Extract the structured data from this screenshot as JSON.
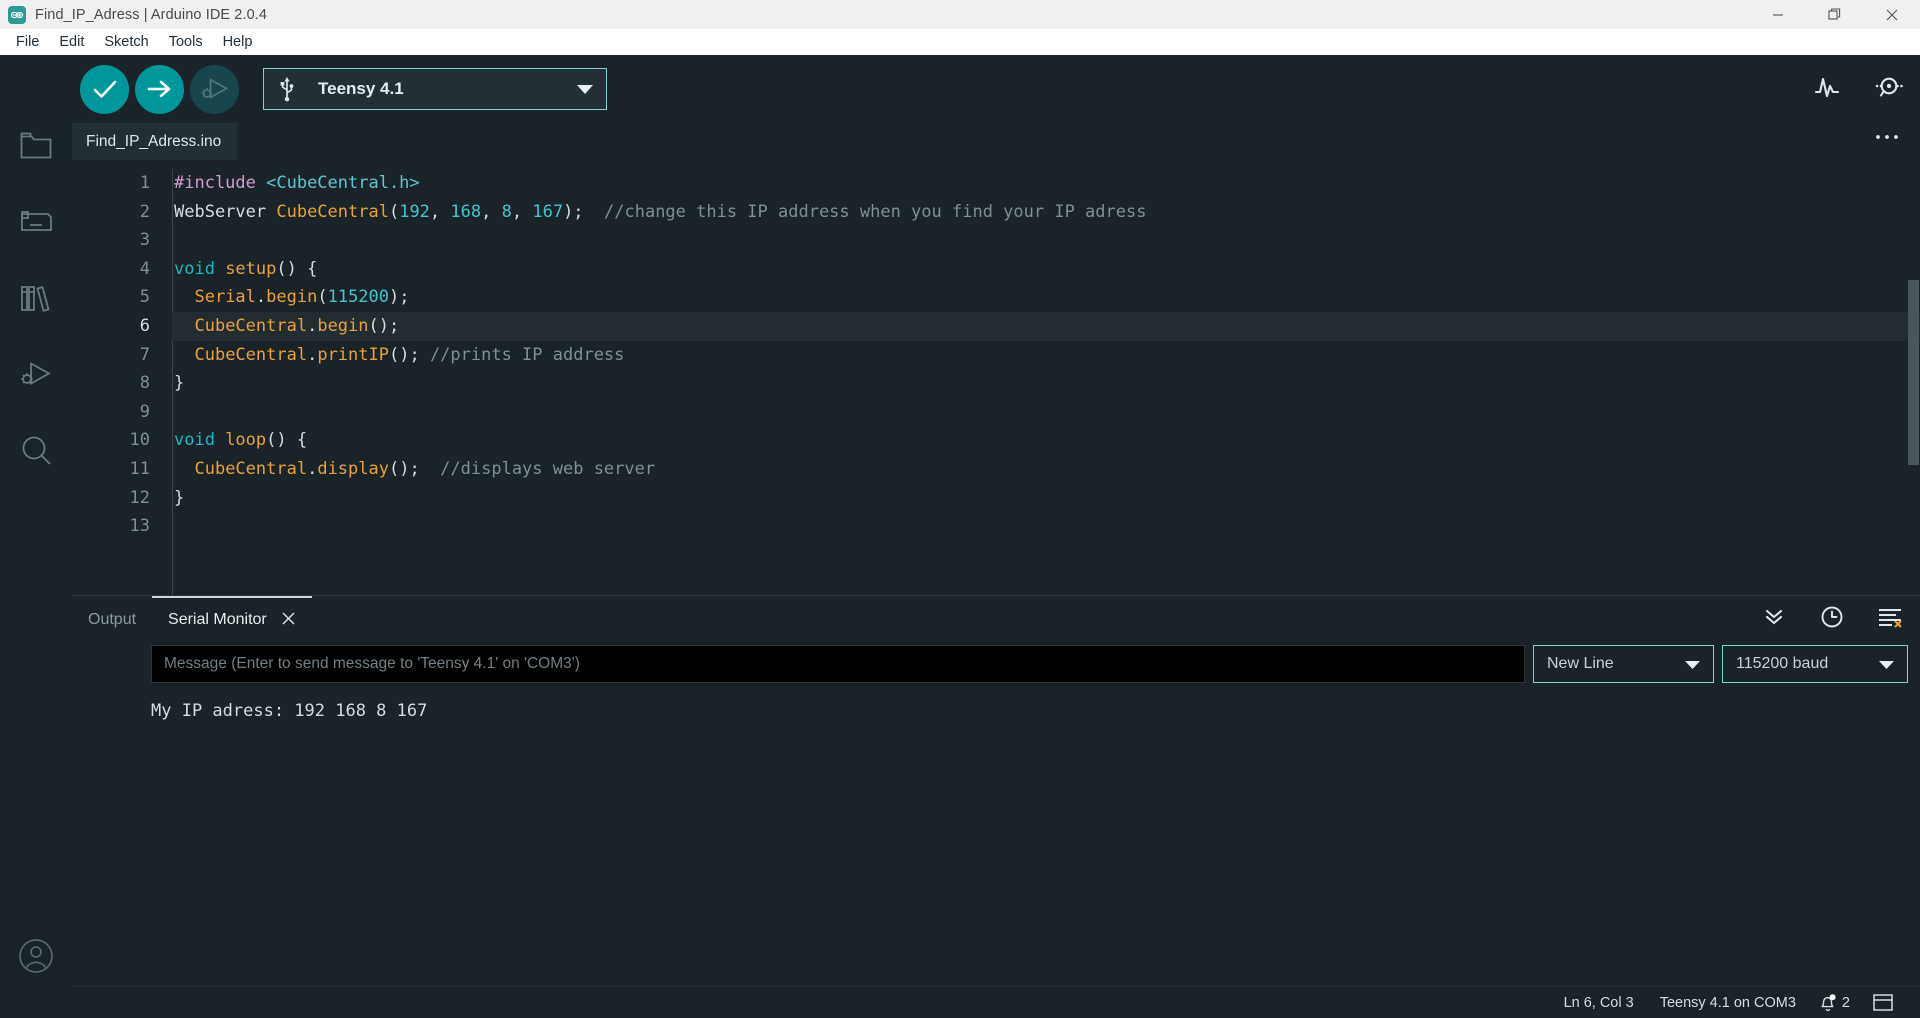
{
  "window": {
    "title": "Find_IP_Adress | Arduino IDE 2.0.4",
    "logo_icon": "arduino-logo-icon",
    "minimize_icon": "minimize-icon",
    "maximize_icon": "maximize-icon",
    "close_icon": "close-icon"
  },
  "menubar": {
    "items": [
      {
        "label": "File",
        "name": "menu-file"
      },
      {
        "label": "Edit",
        "name": "menu-edit"
      },
      {
        "label": "Sketch",
        "name": "menu-sketch"
      },
      {
        "label": "Tools",
        "name": "menu-tools"
      },
      {
        "label": "Help",
        "name": "menu-help"
      }
    ]
  },
  "activitybar": {
    "items": [
      {
        "name": "sidebar-item-sketchbook",
        "icon": "folder-icon"
      },
      {
        "name": "sidebar-item-boards-manager",
        "icon": "board-icon"
      },
      {
        "name": "sidebar-item-library-manager",
        "icon": "books-icon"
      },
      {
        "name": "sidebar-item-debug",
        "icon": "debug-icon"
      },
      {
        "name": "sidebar-item-search",
        "icon": "search-icon"
      }
    ],
    "account": {
      "name": "account-icon",
      "icon": "person-circle-icon"
    }
  },
  "toolbar": {
    "verify": {
      "label": "Verify",
      "icon": "checkmark-icon",
      "color": "#00979c"
    },
    "upload": {
      "label": "Upload",
      "icon": "arrow-right-icon",
      "color": "#00979c"
    },
    "debug": {
      "label": "Debug",
      "icon": "debug-play-icon",
      "color": "#17474d"
    },
    "board_select": {
      "icon": "usb-icon",
      "value": "Teensy 4.1",
      "caret_icon": "chevron-down-icon",
      "border_color": "#7fd4d4"
    },
    "serial_plotter": {
      "name": "serial-plotter-button",
      "icon": "plotter-waveform-icon"
    },
    "serial_monitor": {
      "name": "serial-monitor-button",
      "icon": "serial-monitor-icon"
    }
  },
  "editor": {
    "tab": {
      "label": "Find_IP_Adress.ino",
      "name": "editor-tab-find-ip-adress"
    },
    "more_icon": "ellipsis-icon",
    "active_line": 6,
    "lines": [
      {
        "n": 1,
        "tokens": [
          {
            "t": "#include ",
            "c": "pre"
          },
          {
            "t": "<CubeCentral.h>",
            "c": "str"
          }
        ]
      },
      {
        "n": 2,
        "tokens": [
          {
            "t": "WebServer ",
            "c": "plain"
          },
          {
            "t": "CubeCentral",
            "c": "fn"
          },
          {
            "t": "(",
            "c": "plain"
          },
          {
            "t": "192",
            "c": "num"
          },
          {
            "t": ", ",
            "c": "plain"
          },
          {
            "t": "168",
            "c": "num"
          },
          {
            "t": ", ",
            "c": "plain"
          },
          {
            "t": "8",
            "c": "num"
          },
          {
            "t": ", ",
            "c": "plain"
          },
          {
            "t": "167",
            "c": "num"
          },
          {
            "t": ");  ",
            "c": "plain"
          },
          {
            "t": "//change this IP address when you find your IP adress",
            "c": "cmt"
          }
        ]
      },
      {
        "n": 3,
        "tokens": []
      },
      {
        "n": 4,
        "tokens": [
          {
            "t": "void ",
            "c": "kw"
          },
          {
            "t": "setup",
            "c": "fn"
          },
          {
            "t": "() {",
            "c": "plain"
          }
        ]
      },
      {
        "n": 5,
        "tokens": [
          {
            "t": "  ",
            "c": "plain"
          },
          {
            "t": "Serial",
            "c": "fn"
          },
          {
            "t": ".",
            "c": "plain"
          },
          {
            "t": "begin",
            "c": "fn"
          },
          {
            "t": "(",
            "c": "plain"
          },
          {
            "t": "115200",
            "c": "num"
          },
          {
            "t": ");",
            "c": "plain"
          }
        ]
      },
      {
        "n": 6,
        "tokens": [
          {
            "t": "  ",
            "c": "plain"
          },
          {
            "t": "CubeCentral",
            "c": "fn"
          },
          {
            "t": ".",
            "c": "plain"
          },
          {
            "t": "begin",
            "c": "fn"
          },
          {
            "t": "();",
            "c": "plain"
          }
        ]
      },
      {
        "n": 7,
        "tokens": [
          {
            "t": "  ",
            "c": "plain"
          },
          {
            "t": "CubeCentral",
            "c": "fn"
          },
          {
            "t": ".",
            "c": "plain"
          },
          {
            "t": "printIP",
            "c": "fn"
          },
          {
            "t": "(); ",
            "c": "plain"
          },
          {
            "t": "//prints IP address",
            "c": "cmt"
          }
        ]
      },
      {
        "n": 8,
        "tokens": [
          {
            "t": "}",
            "c": "plain"
          }
        ]
      },
      {
        "n": 9,
        "tokens": []
      },
      {
        "n": 10,
        "tokens": [
          {
            "t": "void ",
            "c": "kw"
          },
          {
            "t": "loop",
            "c": "fn"
          },
          {
            "t": "() {",
            "c": "plain"
          }
        ]
      },
      {
        "n": 11,
        "tokens": [
          {
            "t": "  ",
            "c": "plain"
          },
          {
            "t": "CubeCentral",
            "c": "fn"
          },
          {
            "t": ".",
            "c": "plain"
          },
          {
            "t": "display",
            "c": "fn"
          },
          {
            "t": "();  ",
            "c": "plain"
          },
          {
            "t": "//displays web server",
            "c": "cmt"
          }
        ]
      },
      {
        "n": 12,
        "tokens": [
          {
            "t": "}",
            "c": "plain"
          }
        ]
      },
      {
        "n": 13,
        "tokens": []
      }
    ]
  },
  "panel": {
    "tabs": [
      {
        "label": "Output",
        "name": "panel-tab-output",
        "active": false,
        "closable": false
      },
      {
        "label": "Serial Monitor",
        "name": "panel-tab-serial-monitor",
        "active": true,
        "closable": true,
        "close_icon": "close-icon"
      }
    ],
    "tools": [
      {
        "name": "scroll-to-bottom-button",
        "icon": "double-chevron-down-icon"
      },
      {
        "name": "toggle-timestamp-button",
        "icon": "clock-icon"
      },
      {
        "name": "clear-output-button",
        "icon": "clear-lines-icon"
      }
    ],
    "message_input": {
      "name": "serial-message-input",
      "value": "",
      "placeholder": "Message (Enter to send message to 'Teensy 4.1' on 'COM3')"
    },
    "line_ending_select": {
      "name": "line-ending-select",
      "value": "New Line",
      "caret_icon": "chevron-down-icon"
    },
    "baud_select": {
      "name": "baud-rate-select",
      "value": "115200 baud",
      "caret_icon": "chevron-down-icon"
    },
    "output_lines": [
      "My IP adress: 192 168 8 167"
    ]
  },
  "statusbar": {
    "cursor": "Ln 6, Col 3",
    "board": "Teensy 4.1 on COM3",
    "notifications": {
      "count": "2",
      "icon": "bell-icon"
    },
    "panel_toggle": {
      "name": "toggle-panel-button",
      "icon": "panel-layout-icon"
    }
  }
}
